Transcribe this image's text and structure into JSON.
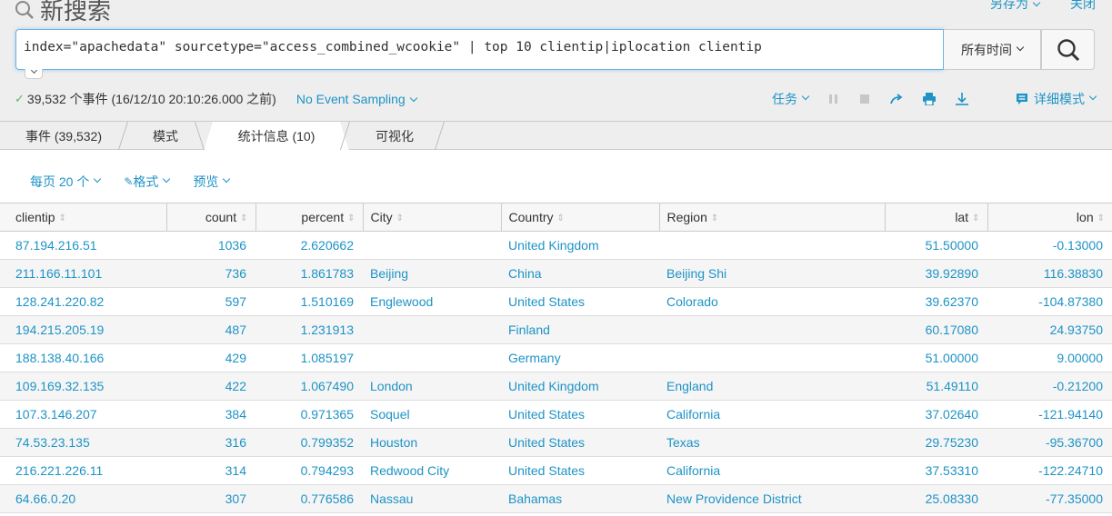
{
  "header": {
    "title": "新搜索",
    "save_as": "另存为",
    "close": "关闭"
  },
  "search": {
    "query": "index=\"apachedata\" sourcetype=\"access_combined_wcookie\" | top 10 clientip|iplocation clientip",
    "time_range": "所有时间"
  },
  "status": {
    "summary": "39,532 个事件 (16/12/10 20:10:26.000 之前)",
    "sampling": "No Event Sampling"
  },
  "jobbar": {
    "job": "任务",
    "mode": "详细模式"
  },
  "tabs": [
    {
      "label": "事件 (39,532)",
      "active": false
    },
    {
      "label": "模式",
      "active": false
    },
    {
      "label": "统计信息 (10)",
      "active": true
    },
    {
      "label": "可视化",
      "active": false
    }
  ],
  "controls": {
    "per_page": "每页 20 个",
    "format": "格式",
    "preview": "预览"
  },
  "table": {
    "columns": [
      "clientip",
      "count",
      "percent",
      "City",
      "Country",
      "Region",
      "lat",
      "lon"
    ],
    "rows": [
      [
        "87.194.216.51",
        "1036",
        "2.620662",
        "",
        "United Kingdom",
        "",
        "51.50000",
        "-0.13000"
      ],
      [
        "211.166.11.101",
        "736",
        "1.861783",
        "Beijing",
        "China",
        "Beijing Shi",
        "39.92890",
        "116.38830"
      ],
      [
        "128.241.220.82",
        "597",
        "1.510169",
        "Englewood",
        "United States",
        "Colorado",
        "39.62370",
        "-104.87380"
      ],
      [
        "194.215.205.19",
        "487",
        "1.231913",
        "",
        "Finland",
        "",
        "60.17080",
        "24.93750"
      ],
      [
        "188.138.40.166",
        "429",
        "1.085197",
        "",
        "Germany",
        "",
        "51.00000",
        "9.00000"
      ],
      [
        "109.169.32.135",
        "422",
        "1.067490",
        "London",
        "United Kingdom",
        "England",
        "51.49110",
        "-0.21200"
      ],
      [
        "107.3.146.207",
        "384",
        "0.971365",
        "Soquel",
        "United States",
        "California",
        "37.02640",
        "-121.94140"
      ],
      [
        "74.53.23.135",
        "316",
        "0.799352",
        "Houston",
        "United States",
        "Texas",
        "29.75230",
        "-95.36700"
      ],
      [
        "216.221.226.11",
        "314",
        "0.794293",
        "Redwood City",
        "United States",
        "California",
        "37.53310",
        "-122.24710"
      ],
      [
        "64.66.0.20",
        "307",
        "0.776586",
        "Nassau",
        "Bahamas",
        "New Providence District",
        "25.08330",
        "-77.35000"
      ]
    ]
  },
  "colors": {
    "link": "#1e93c6",
    "success": "#5cb85c"
  }
}
